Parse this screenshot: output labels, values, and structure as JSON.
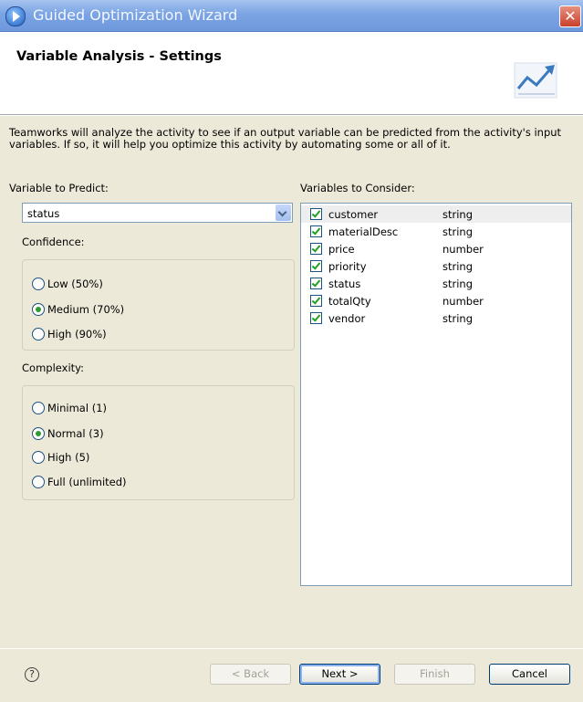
{
  "window": {
    "title": "Guided Optimization Wizard",
    "close_symbol": "✕"
  },
  "header": {
    "title": "Variable Analysis - Settings"
  },
  "description": "Teamworks will analyze the activity to see if an output variable can be predicted from the activity's input variables.  If so, it will help you optimize this activity by automating some or all of it.",
  "predict": {
    "label": "Variable to Predict:",
    "value": "status"
  },
  "confidence": {
    "label": "Confidence:",
    "options": [
      "Low (50%)",
      "Medium (70%)",
      "High (90%)"
    ],
    "selected": "Medium (70%)"
  },
  "complexity": {
    "label": "Complexity:",
    "options": [
      "Minimal (1)",
      "Normal (3)",
      "High (5)",
      "Full (unlimited)"
    ],
    "selected": "Normal (3)"
  },
  "variables": {
    "label": "Variables to Consider:",
    "items": [
      {
        "name": "customer",
        "type": "string",
        "checked": true
      },
      {
        "name": "materialDesc",
        "type": "string",
        "checked": true
      },
      {
        "name": "price",
        "type": "number",
        "checked": true
      },
      {
        "name": "priority",
        "type": "string",
        "checked": true
      },
      {
        "name": "status",
        "type": "string",
        "checked": true
      },
      {
        "name": "totalQty",
        "type": "number",
        "checked": true
      },
      {
        "name": "vendor",
        "type": "string",
        "checked": true
      }
    ]
  },
  "footer": {
    "help_symbol": "?",
    "back": "< Back",
    "next": "Next >",
    "finish": "Finish",
    "cancel": "Cancel"
  },
  "colors": {
    "title_bar": "#7aa4e3",
    "accent_check": "#21a121",
    "window_bg": "#ece9d8"
  }
}
